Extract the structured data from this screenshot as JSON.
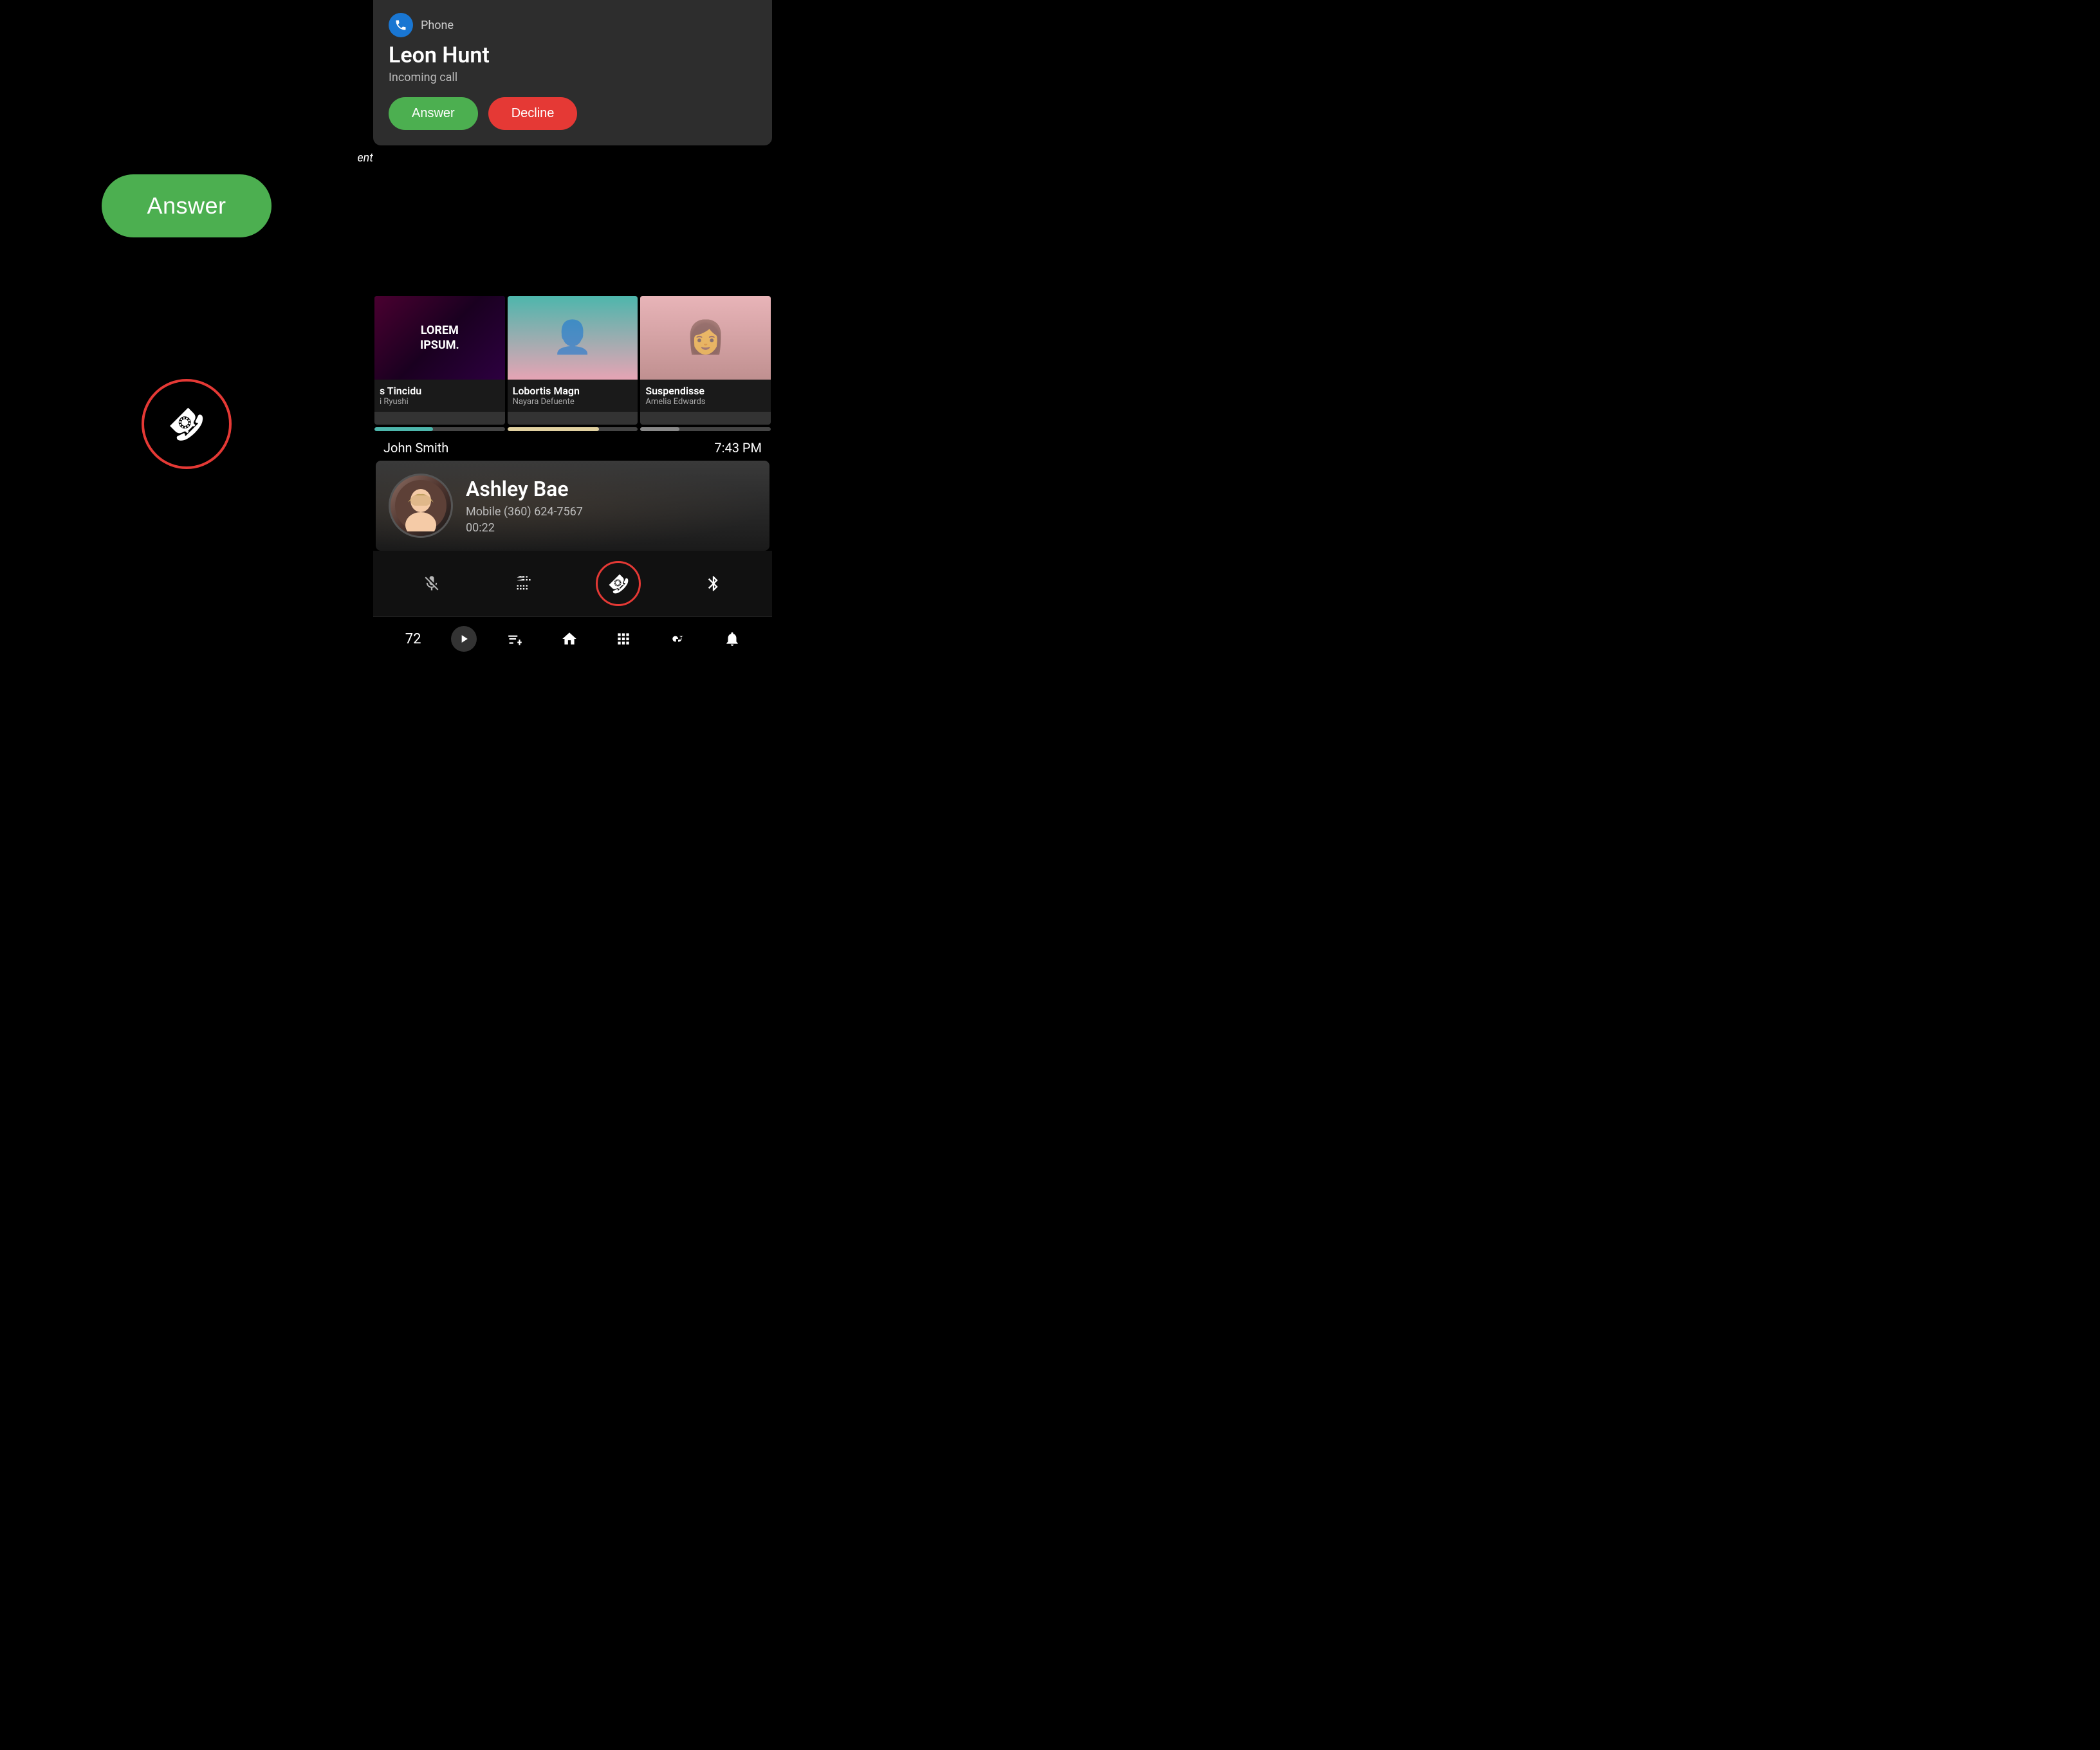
{
  "left": {
    "answer_btn_label": "Answer",
    "end_call_icon": "☎"
  },
  "notification": {
    "app_name": "Phone",
    "caller_name": "Leon Hunt",
    "subtitle": "Incoming call",
    "answer_label": "Answer",
    "decline_label": "Decline"
  },
  "media_cards": [
    {
      "image_text": "LOREM\nIPSUM.",
      "title": "s Tincidu",
      "subtitle": "i Ryushi"
    },
    {
      "title": "Lobortis Magn",
      "subtitle": "Nayara Defuente"
    },
    {
      "title": "Suspendisse",
      "subtitle": "Amelia Edwards"
    }
  ],
  "player_row": {
    "user": "John Smith",
    "time": "7:43 PM"
  },
  "active_call": {
    "caller_name": "Ashley Bae",
    "caller_number": "Mobile (360) 624-7567",
    "duration": "00:22"
  },
  "call_controls": {
    "mute_icon": "🎤",
    "keypad_icon": "⠿",
    "end_icon": "☎",
    "bluetooth_icon": "✦"
  },
  "bottom_nav": {
    "temp": "72",
    "nav_items": [
      "›",
      "⚡",
      "⌂",
      "⠿",
      "✦",
      "🔔"
    ]
  },
  "partial_bg_text": "ent"
}
